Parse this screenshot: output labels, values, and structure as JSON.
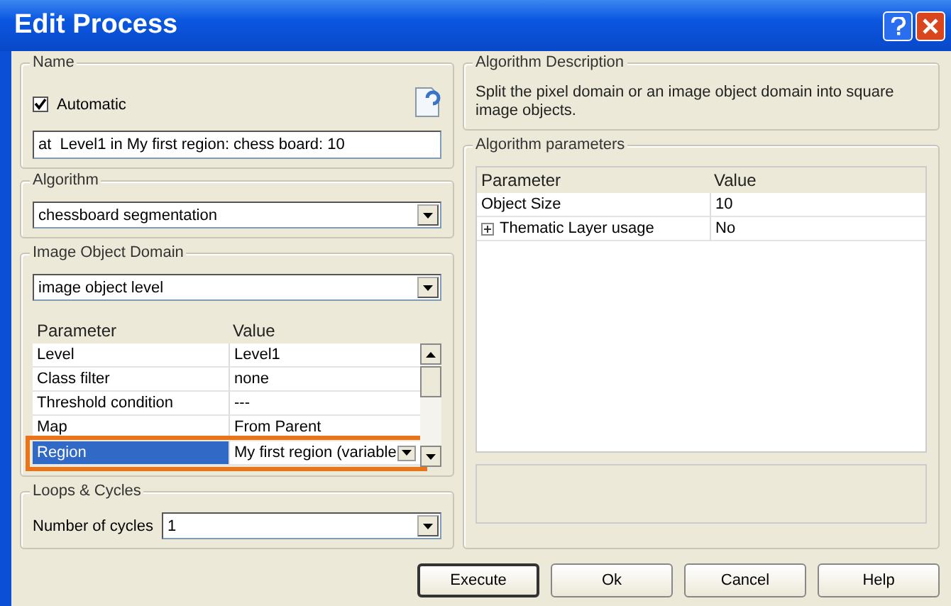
{
  "window": {
    "title": "Edit Process"
  },
  "name_group": {
    "label": "Name",
    "automatic": {
      "label": "Automatic",
      "checked": true
    },
    "value": "at  Level1 in My first region: chess board: 10"
  },
  "algorithm": {
    "label": "Algorithm",
    "value": "chessboard segmentation"
  },
  "domain": {
    "label": "Image Object Domain",
    "value": "image object level",
    "columns": [
      "Parameter",
      "Value"
    ],
    "rows": [
      {
        "parameter": "Level",
        "value": "Level1",
        "selected": false,
        "highlighted": false,
        "kind": "text"
      },
      {
        "parameter": "Class filter",
        "value": "none",
        "selected": false,
        "highlighted": false,
        "kind": "text"
      },
      {
        "parameter": "Threshold condition",
        "value": "---",
        "selected": false,
        "highlighted": false,
        "kind": "text"
      },
      {
        "parameter": "Map",
        "value": "From Parent",
        "selected": false,
        "highlighted": false,
        "kind": "text"
      },
      {
        "parameter": "Region",
        "value": "My first region (variable",
        "selected": true,
        "highlighted": true,
        "kind": "dropdown"
      }
    ]
  },
  "loops": {
    "label": "Loops & Cycles",
    "field_label": "Number of cycles",
    "value": "1"
  },
  "description": {
    "label": "Algorithm Description",
    "text": "Split the pixel domain or an image object domain into square image objects."
  },
  "parameters": {
    "label": "Algorithm parameters",
    "columns": [
      "Parameter",
      "Value"
    ],
    "rows": [
      {
        "parameter": "Object Size",
        "value": "10",
        "expandable": false
      },
      {
        "parameter": "Thematic Layer usage",
        "value": "No",
        "expandable": true
      }
    ]
  },
  "buttons": [
    {
      "label": "Execute",
      "default": true
    },
    {
      "label": "Ok",
      "default": false
    },
    {
      "label": "Cancel",
      "default": false
    },
    {
      "label": "Help",
      "default": false
    }
  ]
}
